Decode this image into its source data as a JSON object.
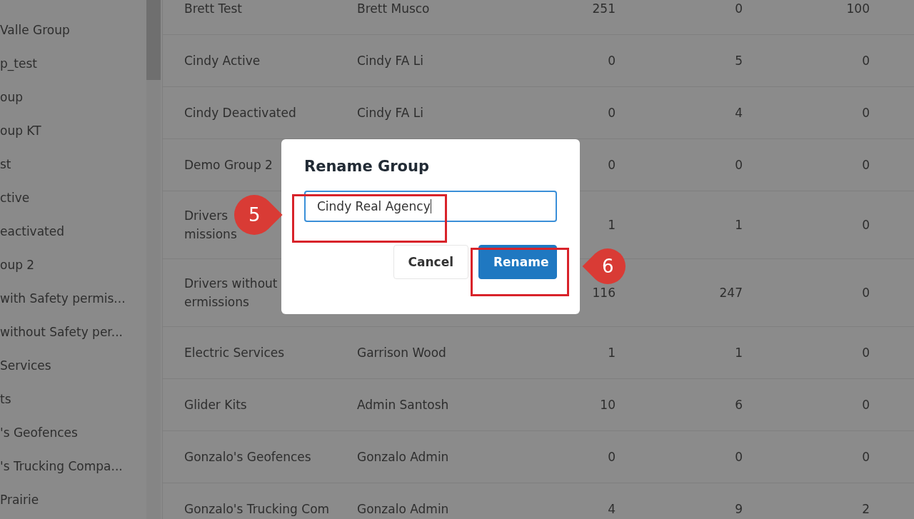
{
  "sidebar": {
    "items": [
      "Valle Group",
      "p_test",
      "oup",
      "oup KT",
      "st",
      "ctive",
      "eactivated",
      "oup 2",
      "with Safety permis...",
      "without Safety per...",
      "Services",
      "ts",
      "'s Geofences",
      "'s Trucking Compa...",
      "Prairie"
    ]
  },
  "table": {
    "rows": [
      {
        "name": [
          "Brett Test"
        ],
        "owner": "Brett Musco",
        "column_3": "251",
        "column_4": "0",
        "column_5": "100"
      },
      {
        "name": [
          "Cindy Active"
        ],
        "owner": "Cindy FA Li",
        "column_3": "0",
        "column_4": "5",
        "column_5": "0"
      },
      {
        "name": [
          "Cindy Deactivated"
        ],
        "owner": "Cindy FA Li",
        "column_3": "0",
        "column_4": "4",
        "column_5": "0"
      },
      {
        "name": [
          "Demo Group 2"
        ],
        "column_3": "0",
        "column_4": "0",
        "column_5": "0"
      },
      {
        "name": [
          "Drivers",
          "missions"
        ],
        "column_3": "1",
        "column_4": "1",
        "column_5": "0"
      },
      {
        "name": [
          "Drivers without",
          "ermissions"
        ],
        "column_3": "116",
        "column_4": "247",
        "column_5": "0"
      },
      {
        "name": [
          "Electric Services"
        ],
        "owner": "Garrison Wood",
        "column_3": "1",
        "column_4": "1",
        "column_5": "0"
      },
      {
        "name": [
          "Glider Kits"
        ],
        "owner": "Admin Santosh",
        "column_3": "10",
        "column_4": "6",
        "column_5": "0"
      },
      {
        "name": [
          "Gonzalo's Geofences"
        ],
        "owner": "Gonzalo Admin",
        "column_3": "0",
        "column_4": "0",
        "column_5": "0"
      },
      {
        "name": [
          "Gonzalo's Trucking Com"
        ],
        "owner": "Gonzalo Admin",
        "column_3": "4",
        "column_4": "9",
        "column_5": "2"
      }
    ]
  },
  "dialog": {
    "title": "Rename Group",
    "field_value": "Cindy Real Agency",
    "buttons": [
      "Cancel",
      "Rename"
    ]
  },
  "annotations": [
    {
      "label": "5"
    },
    {
      "label": "6"
    }
  ]
}
